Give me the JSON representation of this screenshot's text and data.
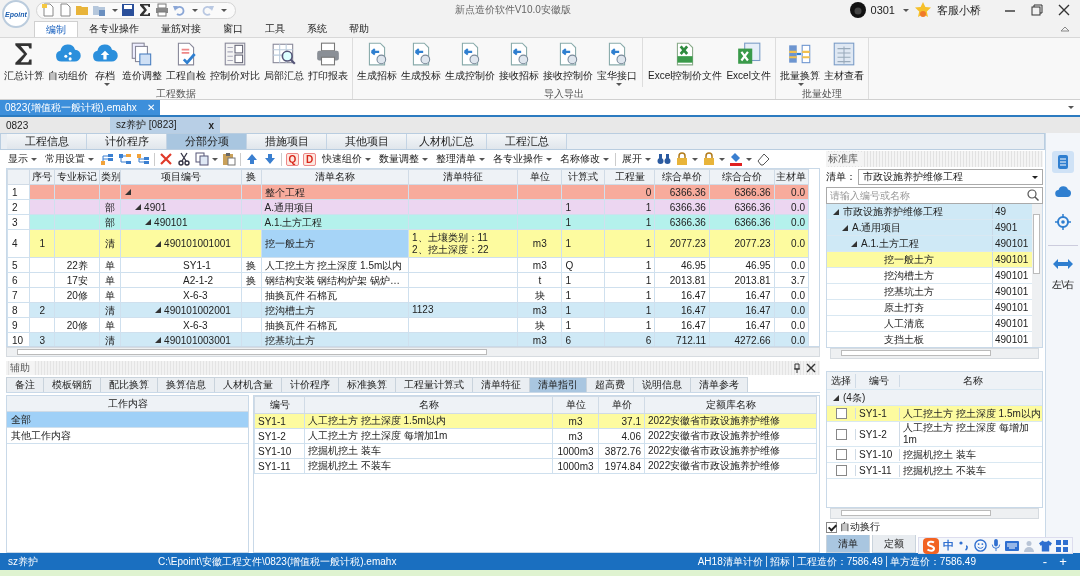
{
  "title_bar": {
    "logo": "Epoint",
    "title": "新点造价软件V10.0安徽版",
    "user": "0301",
    "service": "客服小桥"
  },
  "menu": [
    {
      "label": "编制",
      "selected": true
    },
    {
      "label": "各专业操作",
      "selected": false
    },
    {
      "label": "量筋对接",
      "selected": false
    },
    {
      "label": "窗口",
      "selected": false
    },
    {
      "label": "工具",
      "selected": false
    },
    {
      "label": "系统",
      "selected": false
    },
    {
      "label": "帮助",
      "selected": false
    }
  ],
  "ribbon": [
    {
      "label": "工程数据",
      "sections": [
        [
          {
            "label": "汇总计算"
          },
          {
            "label": "自动组价"
          },
          {
            "label": "存档",
            "dropdown": true
          },
          {
            "label": "造价调整"
          },
          {
            "label": "工程自检"
          },
          {
            "label": "控制价对比"
          },
          {
            "label": "局部汇总"
          },
          {
            "label": "打印报表"
          }
        ]
      ]
    },
    {
      "label": "导入导出",
      "sections": [
        [
          {
            "label": "生成招标"
          },
          {
            "label": "生成投标"
          },
          {
            "label": "生成控制价"
          },
          {
            "label": "接收招标"
          },
          {
            "label": "接收控制价"
          },
          {
            "label": "宝华接口",
            "dropdown": true
          }
        ],
        [
          {
            "label": "Excel控制价文件"
          },
          {
            "label": "Excel文件"
          }
        ]
      ]
    },
    {
      "label": "批量处理",
      "sections": [
        [
          {
            "label": "批量换算",
            "dropdown": true
          },
          {
            "label": "主材查看"
          }
        ]
      ]
    }
  ],
  "file_tabs": [
    {
      "label": "0823(增值税一般计税).emahx",
      "close": "✕",
      "selected": true
    }
  ],
  "doc_tabs": [
    {
      "label": "0823",
      "selected": false
    },
    {
      "label": "sz养护 [0823]",
      "close": "x",
      "selected": true
    }
  ],
  "module_tabs": [
    {
      "label": "工程信息",
      "selected": false
    },
    {
      "label": "计价程序",
      "selected": false
    },
    {
      "label": "分部分项",
      "selected": true
    },
    {
      "label": "措施项目",
      "selected": false
    },
    {
      "label": "其他项目",
      "selected": false
    },
    {
      "label": "人材机汇总",
      "selected": false
    },
    {
      "label": "工程汇总",
      "selected": false
    }
  ],
  "toolbar": [
    {
      "kind": "menu",
      "label": "显示"
    },
    {
      "kind": "menu",
      "label": "常用设置"
    },
    {
      "kind": "icon"
    },
    {
      "kind": "icon"
    },
    {
      "kind": "icon"
    },
    {
      "kind": "sep"
    },
    {
      "kind": "icon"
    },
    {
      "kind": "icon"
    },
    {
      "kind": "icon",
      "dropdown": true
    },
    {
      "kind": "icon"
    },
    {
      "kind": "sep"
    },
    {
      "kind": "icon"
    },
    {
      "kind": "icon"
    },
    {
      "kind": "sep"
    },
    {
      "kind": "glyph",
      "label": "Q"
    },
    {
      "kind": "glyph",
      "label": "D"
    },
    {
      "kind": "menu",
      "label": "快速组价"
    },
    {
      "kind": "menu",
      "label": "数量调整"
    },
    {
      "kind": "menu",
      "label": "整理清单"
    },
    {
      "kind": "menu",
      "label": "各专业操作"
    },
    {
      "kind": "menu",
      "label": "名称修改"
    },
    {
      "kind": "sep"
    },
    {
      "kind": "menu",
      "label": "展开"
    },
    {
      "kind": "icon"
    },
    {
      "kind": "icon",
      "dropdown": true
    },
    {
      "kind": "icon",
      "dropdown": true
    },
    {
      "kind": "icon",
      "dropdown": true
    },
    {
      "kind": "icon"
    }
  ],
  "table": {
    "columns": [
      "序号",
      "专业标记",
      "类别",
      "项目编号",
      "换",
      "清单名称",
      "清单特征",
      "单位",
      "计算式",
      "工程量",
      "综合单价",
      "综合合价",
      "主材单"
    ],
    "rows": [
      {
        "no": "1",
        "name": "整个工程",
        "qty": "0",
        "price": "6366.36",
        "total": "6366.36",
        "material": "0.0",
        "color": "#f8ab9c",
        "selected": false,
        "expanded": true,
        "children": [
          {
            "no": "2",
            "type": "部",
            "code": "4901",
            "name": "A.通用项目",
            "formula": "1",
            "qty": "1",
            "price": "6366.36",
            "total": "6366.36",
            "material": "0.0",
            "color": "#ecd6f1",
            "selected": false,
            "expanded": true,
            "children": [
              {
                "no": "3",
                "type": "部",
                "code": "490101",
                "name": "A.1.土方工程",
                "formula": "1",
                "qty": "1",
                "price": "6366.36",
                "total": "6366.36",
                "material": "0.0",
                "color": "#b4f1ec",
                "selected": false,
                "expanded": true,
                "children": [
                  {
                    "no": "4",
                    "seq": "1",
                    "type": "清",
                    "code": "490101001001",
                    "name": "挖一般土方",
                    "feature": "1、土壤类别：11\n2、挖土深度：22",
                    "unit": "m3",
                    "formula": "1",
                    "qty": "1",
                    "price": "2077.23",
                    "total": "2077.23",
                    "material": "0.0",
                    "color": "#fdfb9f",
                    "selected": true,
                    "expanded": true,
                    "children": [
                      {
                        "no": "5",
                        "mark": "22养",
                        "type": "单",
                        "code": "SY1-1",
                        "swap": "换",
                        "name": "人工挖土方 挖土深度 1.5m以内",
                        "unit": "m3",
                        "formula": "Q",
                        "qty": "1",
                        "price": "46.95",
                        "total": "46.95",
                        "material": "0.0",
                        "color": "#ffffff",
                        "selected": false
                      },
                      {
                        "no": "6",
                        "mark": "17安",
                        "type": "单",
                        "code": "A2-1-2",
                        "swap": "换",
                        "name": "钢结构安装 钢结构炉架 锅炉…",
                        "unit": "t",
                        "formula": "1",
                        "qty": "1",
                        "price": "2013.81",
                        "total": "2013.81",
                        "material": "3.7",
                        "color": "#ffffff",
                        "selected": false
                      },
                      {
                        "no": "7",
                        "mark": "20修",
                        "type": "单",
                        "code": "X-6-3",
                        "name": "抽换瓦件 石棉瓦",
                        "unit": "块",
                        "formula": "1",
                        "qty": "1",
                        "price": "16.47",
                        "total": "16.47",
                        "material": "0.0",
                        "color": "#ffffff",
                        "selected": false
                      }
                    ]
                  },
                  {
                    "no": "8",
                    "seq": "2",
                    "type": "清",
                    "code": "490101002001",
                    "name": "挖沟槽土方",
                    "feature": "1123",
                    "unit": "m3",
                    "formula": "1",
                    "qty": "1",
                    "price": "16.47",
                    "total": "16.47",
                    "material": "0.0",
                    "color": "#cfe9f6",
                    "selected": false,
                    "expanded": true,
                    "children": [
                      {
                        "no": "9",
                        "mark": "20修",
                        "type": "单",
                        "code": "X-6-3",
                        "name": "抽换瓦件 石棉瓦",
                        "unit": "块",
                        "formula": "1",
                        "qty": "1",
                        "price": "16.47",
                        "total": "16.47",
                        "material": "0.0",
                        "color": "#ffffff",
                        "selected": false
                      }
                    ]
                  },
                  {
                    "no": "10",
                    "seq": "3",
                    "type": "清",
                    "code": "490101003001",
                    "name": "挖基坑土方",
                    "unit": "m3",
                    "formula": "6",
                    "qty": "6",
                    "price": "712.11",
                    "total": "4272.66",
                    "material": "0.0",
                    "color": "#cfe9f6",
                    "selected": false,
                    "expanded": true
                  }
                ]
              }
            ]
          }
        ]
      }
    ]
  },
  "aux": {
    "title": "辅助",
    "tabs": [
      {
        "label": "备注",
        "selected": false
      },
      {
        "label": "模板钢筋",
        "selected": false
      },
      {
        "label": "配比换算",
        "selected": false
      },
      {
        "label": "换算信息",
        "selected": false
      },
      {
        "label": "人材机含量",
        "selected": false
      },
      {
        "label": "计价程序",
        "selected": false
      },
      {
        "label": "标准换算",
        "selected": false
      },
      {
        "label": "工程量计算式",
        "selected": false
      },
      {
        "label": "清单特征",
        "selected": false
      },
      {
        "label": "清单指引",
        "selected": true
      },
      {
        "label": "超高费",
        "selected": false
      },
      {
        "label": "说明信息",
        "selected": false
      },
      {
        "label": "清单参考",
        "selected": false
      }
    ],
    "work_header": "工作内容",
    "work_items": [
      {
        "label": "全部",
        "selected": true
      },
      {
        "label": "其他工作内容",
        "selected": false
      }
    ],
    "guide_columns": [
      "编号",
      "名称",
      "单位",
      "单价",
      "定额库名称"
    ],
    "guide_rows": [
      {
        "code": "SY1-1",
        "name": "人工挖土方 挖土深度 1.5m以内",
        "unit": "m3",
        "price": "37.1",
        "library": "2022安徽省市政设施养护维修",
        "selected": true
      },
      {
        "code": "SY1-2",
        "name": "人工挖土方 挖土深度 每增加1m",
        "unit": "m3",
        "price": "4.06",
        "library": "2022安徽省市政设施养护维修",
        "selected": false
      },
      {
        "code": "SY1-10",
        "name": "挖掘机挖土 装车",
        "unit": "1000m3",
        "price": "3872.76",
        "library": "2022安徽省市政设施养护维修",
        "selected": false
      },
      {
        "code": "SY1-11",
        "name": "挖掘机挖土 不装车",
        "unit": "1000m3",
        "price": "1974.84",
        "library": "2022安徽省市政设施养护维修",
        "selected": false
      }
    ]
  },
  "library": {
    "title": "标准库",
    "list_label": "清单：",
    "list_value": "市政设施养护维修工程",
    "search": {
      "placeholder": "请输入编号或名称"
    },
    "tree": [
      {
        "name": "市政设施养护维修工程",
        "code": "49",
        "expanded": true,
        "selected": false,
        "children": [
          {
            "name": "A.通用项目",
            "code": "4901",
            "expanded": true,
            "selected": false,
            "children": [
              {
                "name": "A.1.土方工程",
                "code": "490101",
                "expanded": true,
                "selected": false,
                "children": [
                  {
                    "name": "挖一般土方",
                    "code": "490101",
                    "selected": true
                  },
                  {
                    "name": "挖沟槽土方",
                    "code": "490101",
                    "selected": false
                  },
                  {
                    "name": "挖基坑土方",
                    "code": "490101",
                    "selected": false
                  },
                  {
                    "name": "原土打夯",
                    "code": "490101",
                    "selected": false
                  },
                  {
                    "name": "人工清底",
                    "code": "490101",
                    "selected": false
                  },
                  {
                    "name": "支挡土板",
                    "code": "490101",
                    "selected": false
                  }
                ]
              }
            ]
          }
        ]
      }
    ],
    "pick_columns": [
      "选择",
      "编号",
      "名称"
    ],
    "pick_group": {
      "label": "(4条)",
      "expanded": true
    },
    "pick_rows": [
      {
        "code": "SY1-1",
        "name": "人工挖土方 挖土深度 1.5m以内",
        "checked": false,
        "selected": true
      },
      {
        "code": "SY1-2",
        "name": "人工挖土方 挖土深度 每增加1m",
        "checked": false,
        "selected": false
      },
      {
        "code": "SY1-10",
        "name": "挖掘机挖土 装车",
        "checked": false,
        "selected": false
      },
      {
        "code": "SY1-11",
        "name": "挖掘机挖土 不装车",
        "checked": false,
        "selected": false
      }
    ],
    "wrap": {
      "label": "自动换行",
      "checked": true
    },
    "tabs": [
      {
        "label": "清单",
        "selected": true
      },
      {
        "label": "定额",
        "selected": false
      }
    ]
  },
  "side_tools": [
    {
      "selected": true
    },
    {
      "selected": false
    },
    {
      "selected": false
    }
  ],
  "side_label": "左\\右",
  "ime": {
    "label": "中"
  },
  "status_bar": {
    "project": "sz养护",
    "path": "C:\\Epoint\\安徽工程文件\\0823(增值税一般计税).emahx",
    "items": [
      "AH18清单计价",
      "招标",
      "工程造价：7586.49",
      "单方造价：7586.49"
    ],
    "zoom_out": "-",
    "zoom_in": "+"
  }
}
